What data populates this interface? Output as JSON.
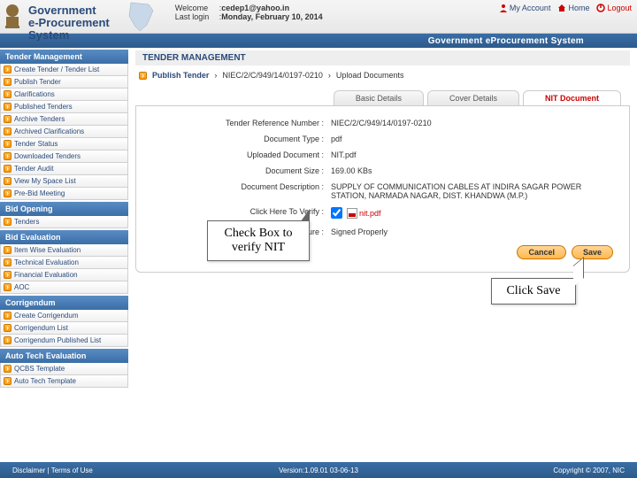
{
  "header": {
    "site_line1": "Government",
    "site_line2": "e-Procurement",
    "site_line3": "System",
    "welcome_lbl": "Welcome",
    "welcome_val": "cedep1@yahoo.in",
    "lastlogin_lbl": "Last login",
    "lastlogin_val": "Monday, February 10, 2014",
    "links": {
      "account": "My Account",
      "home": "Home",
      "logout": "Logout"
    }
  },
  "bluebar": "Government eProcurement System",
  "sidebar": {
    "sections": [
      {
        "title": "Tender Management",
        "items": [
          "Create Tender / Tender List",
          "Publish Tender",
          "Clarifications",
          "Published Tenders",
          "Archive Tenders",
          "Archived Clarifications",
          "Tender Status",
          "Downloaded Tenders",
          "Tender Audit",
          "View My Space List",
          "Pre-Bid Meeting"
        ]
      },
      {
        "title": "Bid Opening",
        "items": [
          "Tenders"
        ]
      },
      {
        "title": "Bid Evaluation",
        "items": [
          "Item Wise Evaluation",
          "Technical Evaluation",
          "Financial Evaluation",
          "AOC"
        ]
      },
      {
        "title": "Corrigendum",
        "items": [
          "Create Corrigendum",
          "Corrigendum List",
          "Corrigendum Published List"
        ]
      },
      {
        "title": "Auto Tech Evaluation",
        "items": [
          "QCBS Template",
          "Auto Tech Template"
        ]
      }
    ]
  },
  "content": {
    "head": "TENDER MANAGEMENT",
    "breadcrumb": {
      "strong": "Publish Tender",
      "ref": "NIEC/2/C/949/14/0197-0210",
      "tail": "Upload Documents"
    },
    "tabs": [
      "Basic Details",
      "Cover Details",
      "NIT Document"
    ],
    "active_tab": 2,
    "fields": {
      "ref_lbl": "Tender Reference Number :",
      "ref_val": "NIEC/2/C/949/14/0197-0210",
      "type_lbl": "Document Type :",
      "type_val": "pdf",
      "updoc_lbl": "Uploaded Document :",
      "updoc_val": "NIT.pdf",
      "size_lbl": "Document Size :",
      "size_val": "169.00  KBs",
      "desc_lbl": "Document Description :",
      "desc_val": "SUPPLY OF COMMUNICATION CABLES AT INDIRA SAGAR POWER STATION, NARMADA NAGAR, DIST. KHANDWA (M.P.)",
      "verify_lbl": "Click Here To Verify :",
      "verify_link": "nit.pdf",
      "sig_lbl": "Digital Signature :",
      "sig_val": "Signed Properly"
    },
    "buttons": {
      "cancel": "Cancel",
      "save": "Save"
    }
  },
  "callouts": {
    "verify": "Check Box to verify NIT",
    "save": "Click Save"
  },
  "footer": {
    "left": "Disclaimer  |  Terms of Use",
    "mid": "Version:1.09.01 03-06-13",
    "right": "Copyright © 2007, NIC"
  }
}
